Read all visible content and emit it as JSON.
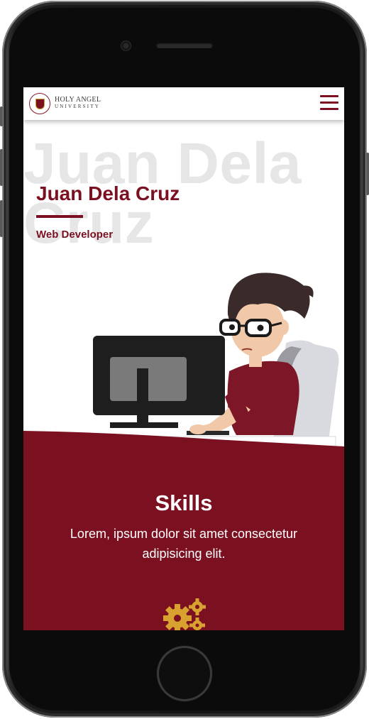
{
  "brand": {
    "name_line1": "HOLY ANGEL",
    "name_line2": "UNIVERSITY",
    "logo_icon": "university-seal"
  },
  "nav": {
    "menu_icon": "hamburger-menu-icon"
  },
  "hero": {
    "background_text": "Juan Dela Cruz",
    "name": "Juan Dela Cruz",
    "role": "Web Developer",
    "illustration": "developer-at-computer"
  },
  "skills": {
    "title": "Skills",
    "description": "Lorem, ipsum dolor sit amet consectetur adipisicing elit.",
    "icon": "gears-icon"
  },
  "colors": {
    "primary": "#7a1020",
    "accent": "#d9a12f",
    "watermark": "#e6e6e6"
  }
}
